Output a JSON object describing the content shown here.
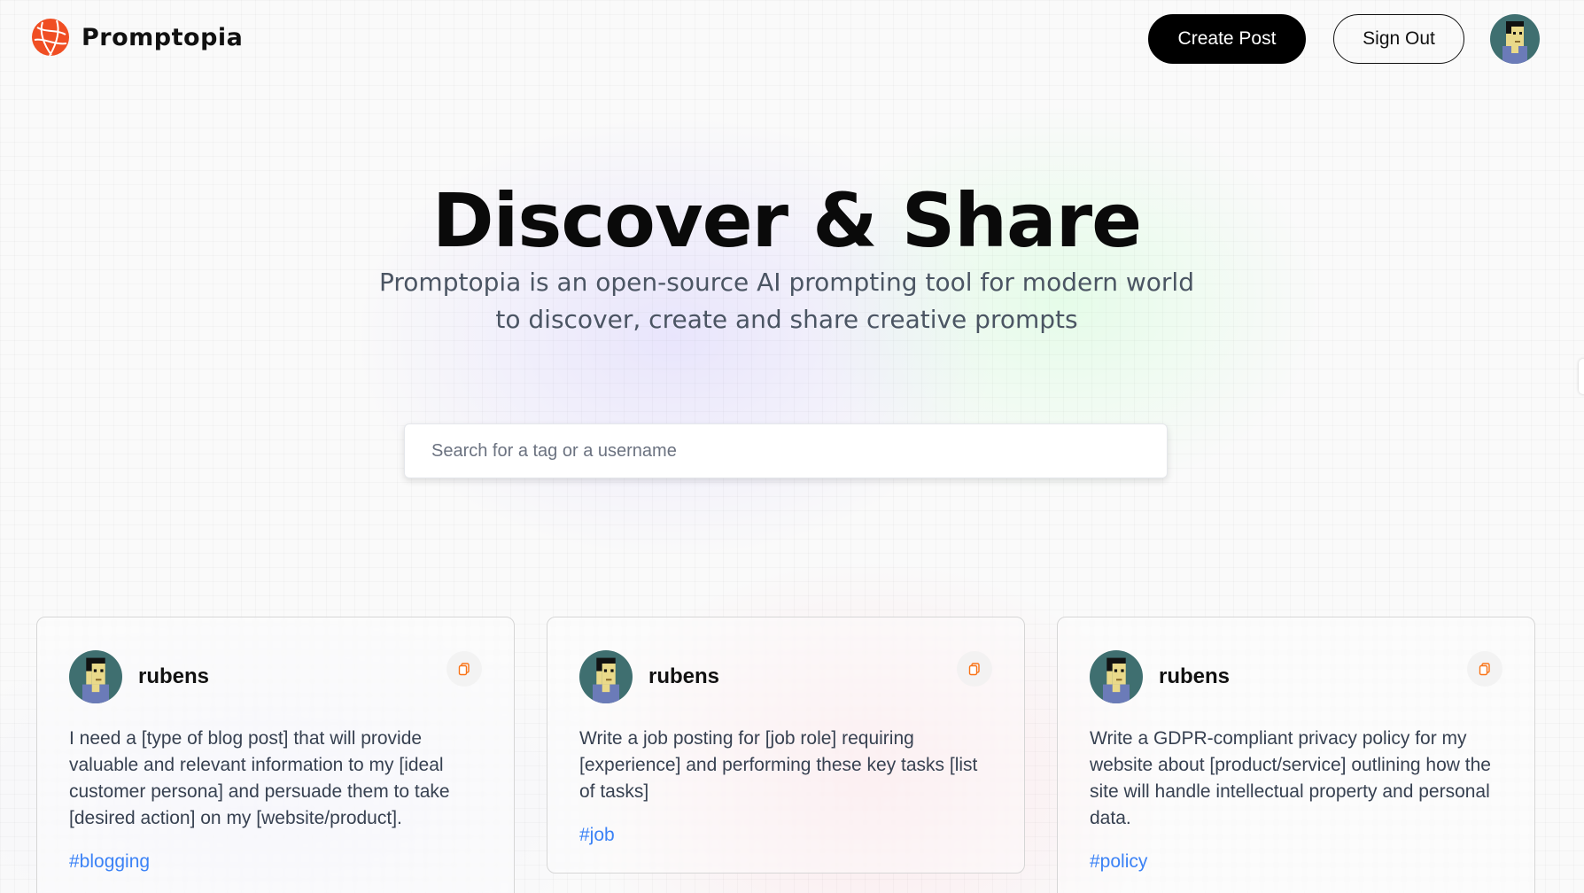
{
  "brand": {
    "name": "Promptopia",
    "accent": "#f04e23"
  },
  "nav": {
    "create_label": "Create Post",
    "signout_label": "Sign Out",
    "profile_icon": "pixel-avatar-icon"
  },
  "hero": {
    "title": "Discover & Share",
    "subtitle": "Promptopia is an open-source AI prompting tool for modern world to discover, create and share creative prompts"
  },
  "search": {
    "placeholder": "Search for a tag or a username",
    "value": ""
  },
  "feed": {
    "cards": [
      {
        "username": "rubens",
        "prompt": "I need a [type of blog post] that will provide valuable and relevant information to my [ideal customer persona] and persuade them to take [desired action] on my [website/product].",
        "tag": "#blogging",
        "copy_icon": "copy-icon"
      },
      {
        "username": "rubens",
        "prompt": "Write a job posting for [job role] requiring [experience] and performing these key tasks [list of tasks]",
        "tag": "#job",
        "copy_icon": "copy-icon"
      },
      {
        "username": "rubens",
        "prompt": "Write a GDPR-compliant privacy policy for my website about [product/service] outlining how the site will handle intellectual property and personal data.",
        "tag": "#policy",
        "copy_icon": "copy-icon"
      }
    ]
  },
  "colors": {
    "tag": "#3b82f6",
    "button_dark": "#000000",
    "copy_icon": "#f97316"
  }
}
